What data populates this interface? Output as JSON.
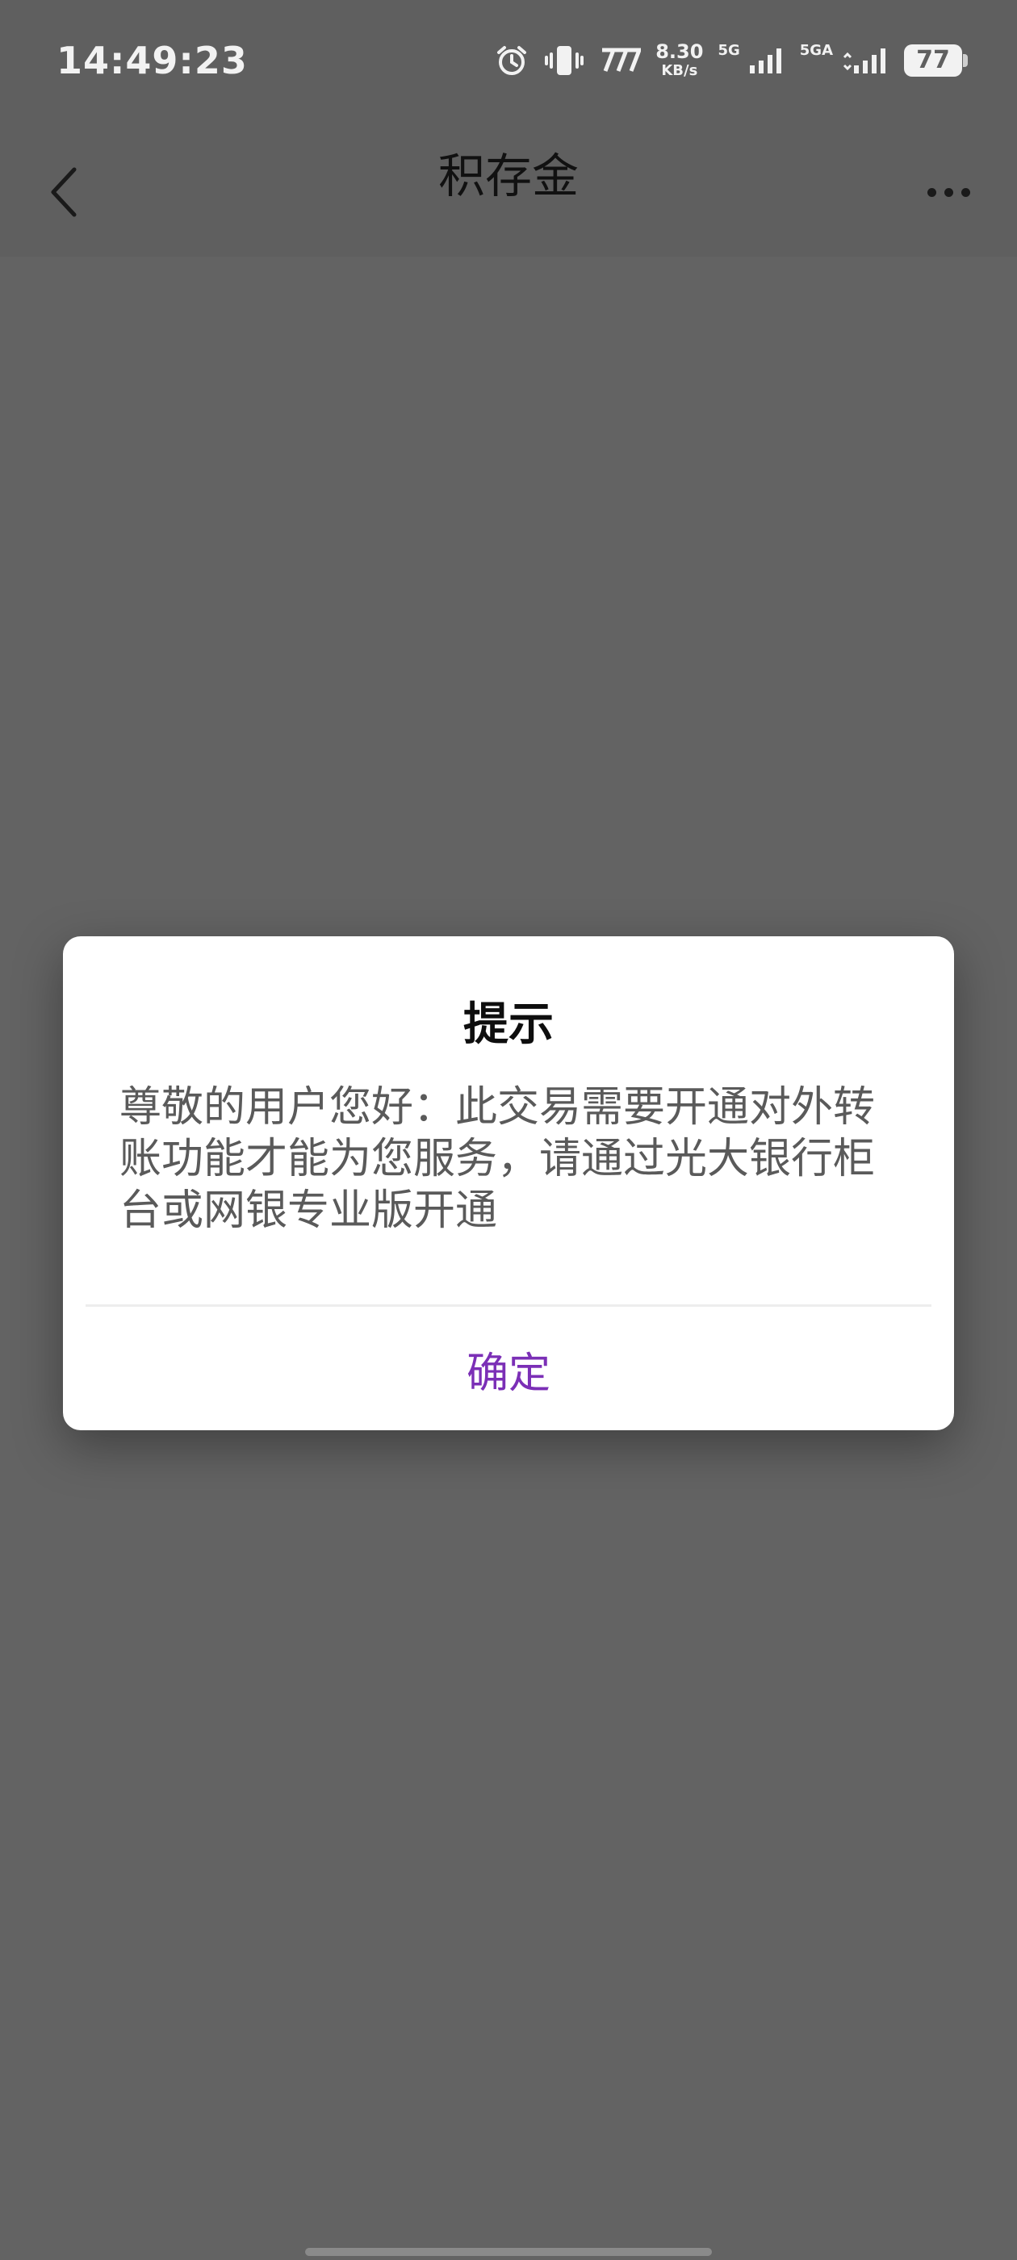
{
  "status_bar": {
    "time": "14:49:23",
    "network_speed_value": "8.30",
    "network_speed_unit": "KB/s",
    "sim1_label": "5G",
    "sim2_label": "5GA",
    "battery_level": "77",
    "icons": [
      "alarm-icon",
      "vibrate-icon",
      "carrier-icon",
      "signal-icon",
      "signal-icon"
    ]
  },
  "header": {
    "title": "积存金",
    "back_icon": "chevron-left-icon",
    "more_icon": "more-dots-icon"
  },
  "dialog": {
    "title": "提示",
    "message": "尊敬的用户您好：此交易需要开通对外转账功能才能为您服务，请通过光大银行柜台或网银专业版开通",
    "confirm_label": "确定"
  },
  "colors": {
    "accent": "#7b2fb6",
    "overlay": "#626262"
  }
}
